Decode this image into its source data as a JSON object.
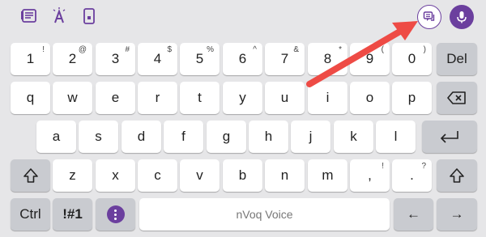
{
  "toolbar": {
    "icons": [
      "clipboard-list-icon",
      "text-format-icon",
      "phone-device-icon",
      "voice-panel-icon",
      "microphone-icon"
    ],
    "accent": "#6b3f9e"
  },
  "rows": {
    "numbers": [
      {
        "main": "1",
        "hint": "!"
      },
      {
        "main": "2",
        "hint": "@"
      },
      {
        "main": "3",
        "hint": "#"
      },
      {
        "main": "4",
        "hint": "$"
      },
      {
        "main": "5",
        "hint": "%"
      },
      {
        "main": "6",
        "hint": "^"
      },
      {
        "main": "7",
        "hint": "&"
      },
      {
        "main": "8",
        "hint": "*"
      },
      {
        "main": "9",
        "hint": "("
      },
      {
        "main": "0",
        "hint": ")"
      }
    ],
    "del": "Del",
    "qwerty": [
      "q",
      "w",
      "e",
      "r",
      "t",
      "y",
      "u",
      "i",
      "o",
      "p"
    ],
    "asdf": [
      "a",
      "s",
      "d",
      "f",
      "g",
      "h",
      "j",
      "k",
      "l"
    ],
    "zxcv": [
      {
        "main": "z",
        "hint": ""
      },
      {
        "main": "x",
        "hint": ""
      },
      {
        "main": "c",
        "hint": ""
      },
      {
        "main": "v",
        "hint": ""
      },
      {
        "main": "b",
        "hint": ""
      },
      {
        "main": "n",
        "hint": ""
      },
      {
        "main": "m",
        "hint": ""
      },
      {
        "main": ",",
        "hint": "!"
      },
      {
        "main": ".",
        "hint": "?"
      }
    ],
    "bottom": {
      "ctrl": "Ctrl",
      "symbols": "!#1",
      "space": "nVoq Voice",
      "left": "←",
      "right": "→"
    }
  },
  "annotation_color": "#ee4b45"
}
